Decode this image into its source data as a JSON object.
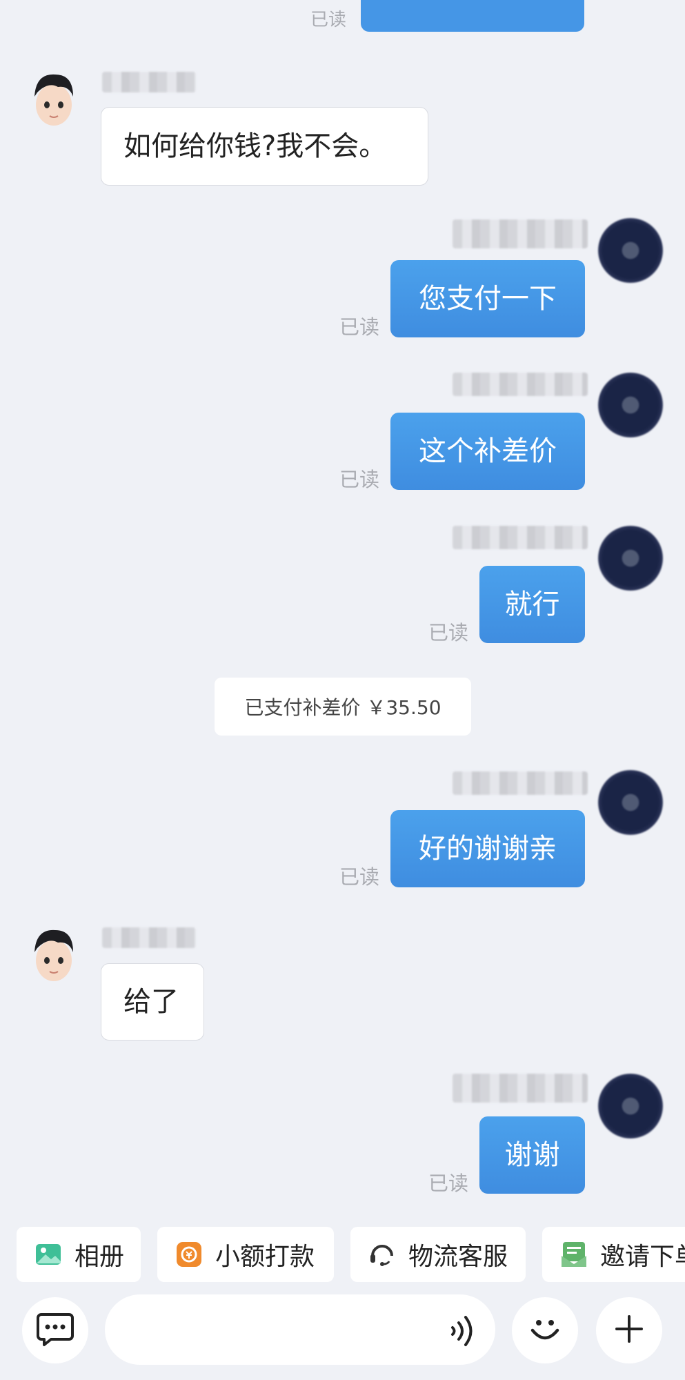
{
  "messages": {
    "top_read_label": "已读",
    "m1_text": "如何给你钱?我不会。",
    "m2_text": "您支付一下",
    "m3_text": "这个补差价",
    "m4_text": "就行",
    "system_text": "已支付补差价 ￥35.50",
    "m5_text": "好的谢谢亲",
    "m6_text": "给了",
    "m7_text": "谢谢",
    "read_label": "已读"
  },
  "quick_actions": [
    {
      "label": "相册",
      "icon": "photo-album-icon",
      "color": "#3fbf97"
    },
    {
      "label": "小额打款",
      "icon": "payment-icon",
      "color": "#f08a2c"
    },
    {
      "label": "物流客服",
      "icon": "customer-service-icon",
      "color": "#333333"
    },
    {
      "label": "邀请下单",
      "icon": "invite-order-icon",
      "color": "#5fb36a"
    }
  ],
  "input_bar": {
    "message_icon": "chat-bubble-icon",
    "voice_icon": "voice-wave-icon",
    "emoji_icon": "smile-icon",
    "plus_icon": "plus-icon"
  },
  "colors": {
    "background": "#eff1f6",
    "outgoing_bubble": "#4596e6",
    "incoming_bubble": "#ffffff"
  }
}
